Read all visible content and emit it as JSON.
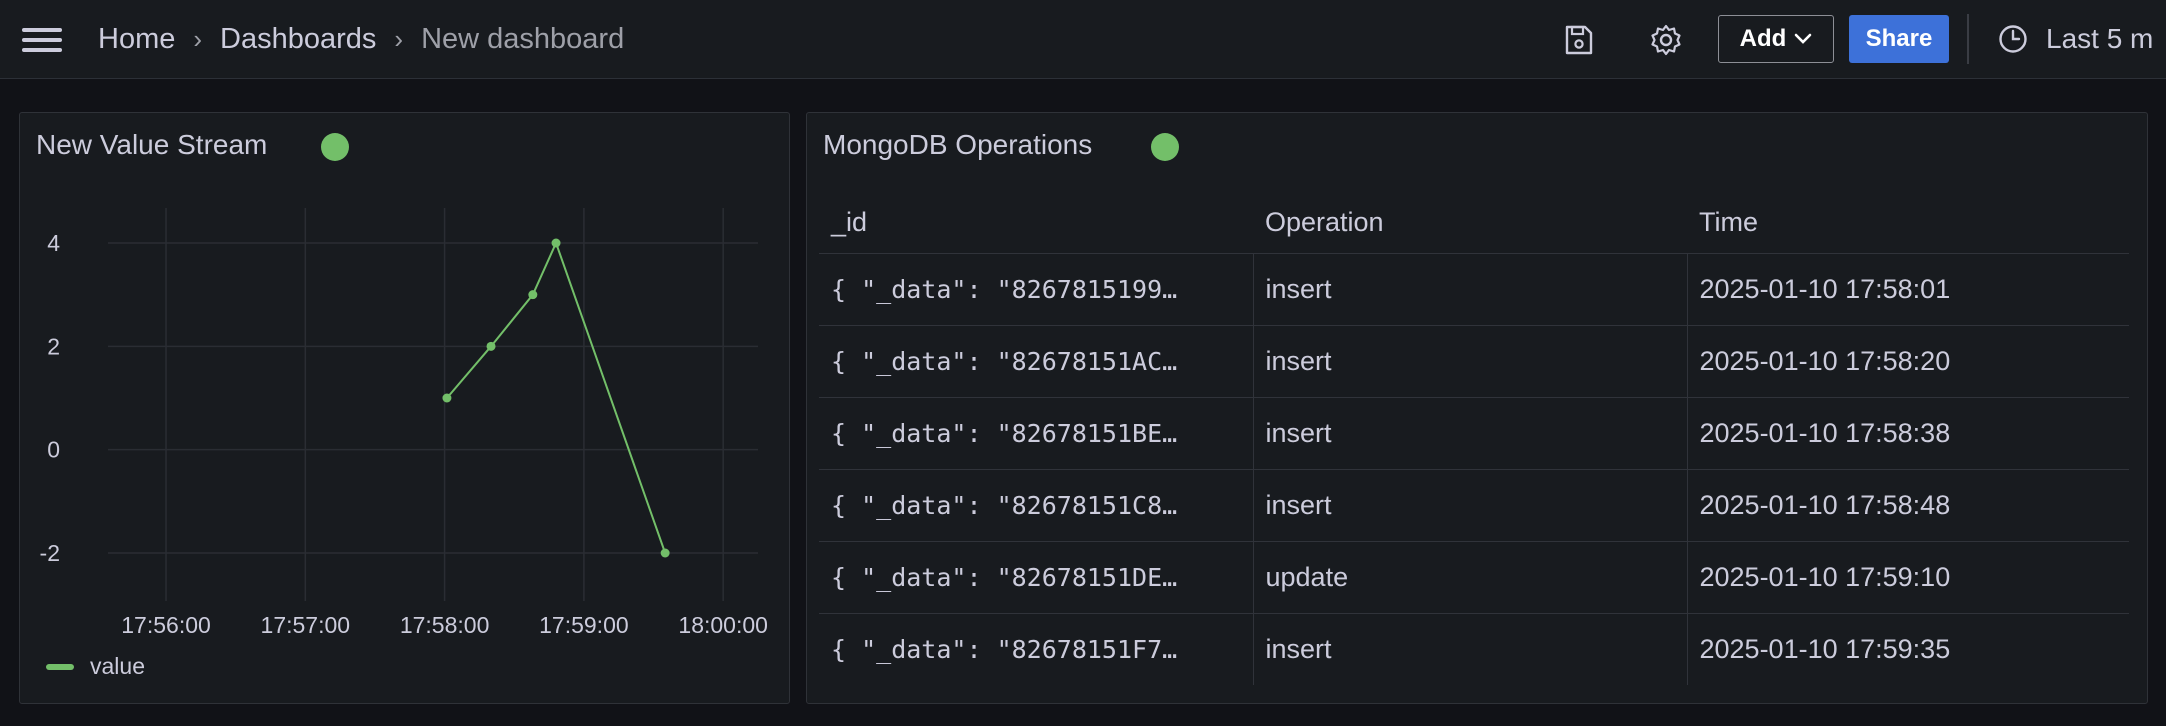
{
  "breadcrumb": {
    "home": "Home",
    "dashboards": "Dashboards",
    "current": "New dashboard"
  },
  "toolbar": {
    "add_label": "Add",
    "share_label": "Share",
    "time_range": "Last 5 m"
  },
  "icons": [
    "menu-icon",
    "save-icon",
    "gear-icon",
    "chevron-down-icon",
    "clock-icon"
  ],
  "colors": {
    "accent": "#3d71d9",
    "series": "#73bf69",
    "status_ok": "#73bf69",
    "background": "#111217",
    "panel": "#181b1f"
  },
  "panels": {
    "value_stream": {
      "title": "New Value Stream"
    },
    "mongo_ops": {
      "title": "MongoDB Operations",
      "columns": [
        "_id",
        "Operation",
        "Time"
      ],
      "rows": [
        {
          "id": "{ \"_data\": \"8267815199…",
          "operation": "insert",
          "time": "2025-01-10 17:58:01"
        },
        {
          "id": "{ \"_data\": \"82678151AC…",
          "operation": "insert",
          "time": "2025-01-10 17:58:20"
        },
        {
          "id": "{ \"_data\": \"82678151BE…",
          "operation": "insert",
          "time": "2025-01-10 17:58:38"
        },
        {
          "id": "{ \"_data\": \"82678151C8…",
          "operation": "insert",
          "time": "2025-01-10 17:58:48"
        },
        {
          "id": "{ \"_data\": \"82678151DE…",
          "operation": "update",
          "time": "2025-01-10 17:59:10"
        },
        {
          "id": "{ \"_data\": \"82678151F7…",
          "operation": "insert",
          "time": "2025-01-10 17:59:35"
        }
      ]
    }
  },
  "chart_data": {
    "type": "line",
    "title": "New Value Stream",
    "x_ticks": [
      "17:56:00",
      "17:57:00",
      "17:58:00",
      "17:59:00",
      "18:00:00"
    ],
    "y_ticks": [
      "4",
      "2",
      "0",
      "-2"
    ],
    "ylim": [
      -2,
      4
    ],
    "xlim": [
      "17:55:35",
      "18:00:15"
    ],
    "grid": true,
    "legend_position": "bottom-left",
    "series": [
      {
        "name": "value",
        "color": "#73bf69",
        "x": [
          "17:58:01",
          "17:58:20",
          "17:58:38",
          "17:58:48",
          "17:59:35"
        ],
        "y": [
          1,
          2,
          3,
          4,
          -2
        ]
      }
    ]
  }
}
